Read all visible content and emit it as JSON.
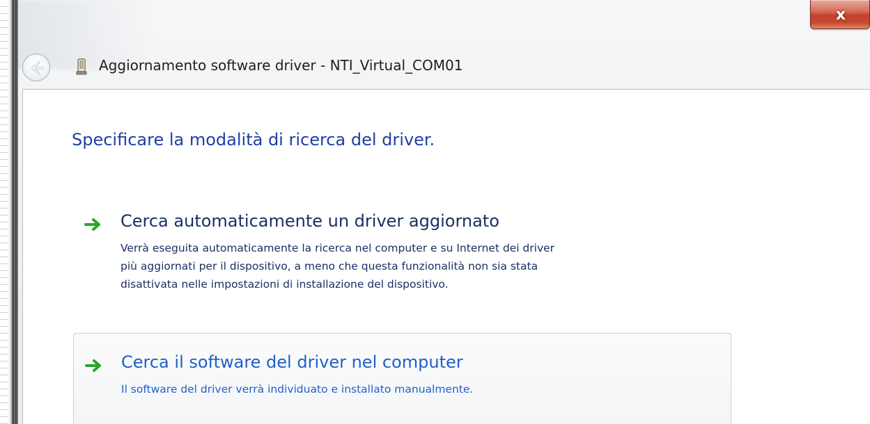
{
  "window": {
    "title": "Aggiornamento software driver - NTI_Virtual_COM01",
    "close_glyph": "x",
    "colors": {
      "close_button": "#c74a31",
      "instruction": "#1e3fa6",
      "link_text": "#1f60c8",
      "arrow_green": "#2aa52a"
    }
  },
  "header": {
    "back_icon": "back-arrow-icon",
    "device_icon": "device-icon"
  },
  "content": {
    "main_instruction": "Specificare la modalità di ricerca del driver.",
    "options": [
      {
        "icon": "green-arrow-icon",
        "title": "Cerca automaticamente un driver aggiornato",
        "description_lines": [
          "Verrà eseguita automaticamente la ricerca nel computer e su Internet dei driver",
          "più aggiornati per il dispositivo, a meno che questa funzionalità non sia stata",
          "disattivata nelle impostazioni di installazione del dispositivo."
        ],
        "state": "normal"
      },
      {
        "icon": "green-arrow-icon",
        "title": "Cerca il software del driver nel computer",
        "description_lines": [
          "Il software del driver verrà individuato e installato manualmente."
        ],
        "state": "hover"
      }
    ]
  }
}
